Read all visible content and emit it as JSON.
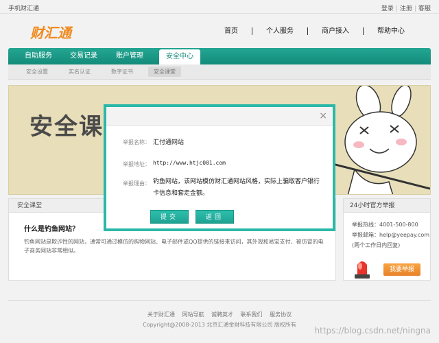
{
  "topbar": {
    "site_name": "手机财汇通",
    "login": "登录",
    "register": "注册",
    "service": "客服",
    "sep": "|"
  },
  "logo": {
    "text": "财汇通"
  },
  "main_nav": [
    {
      "label": "首页"
    },
    {
      "label": "个人服务"
    },
    {
      "label": "商户接入"
    },
    {
      "label": "帮助中心"
    }
  ],
  "tabs": [
    {
      "label": "自助服务"
    },
    {
      "label": "交易记录"
    },
    {
      "label": "账户管理"
    },
    {
      "label": "安全中心",
      "active": true
    }
  ],
  "subnav": [
    {
      "label": "安全设置"
    },
    {
      "label": "实名认证"
    },
    {
      "label": "数字证书"
    },
    {
      "label": "安全课堂",
      "active": true
    }
  ],
  "banner": {
    "title": "安全课堂"
  },
  "lesson": {
    "header": "安全课堂",
    "question": "什么是钓鱼网站？",
    "answer": "钓鱼网站是欺诈性的网站，通常可通过模仿的购物网站、电子邮件或QQ提供的链接来访问，其外观和易宝支付、被仿冒的电子商务网站非常相似。"
  },
  "report": {
    "header": "24小时官方举报",
    "hotline_label": "举报热线：",
    "hotline": "4001-500-800",
    "email_label": "举报邮箱：",
    "email": "help@yeepay.com",
    "hours": "(两个工作日内回复)",
    "button": "我要举报"
  },
  "footer": {
    "links": [
      "关于财汇通",
      "网站导航",
      "诚聘英才",
      "联系我们",
      "服务协议"
    ],
    "copyright": "Copyright@2008-2013 北京汇通金财科技有限公司 版权所有"
  },
  "watermark": "https://blog.csdn.net/ningna",
  "modal": {
    "close_glyph": "×",
    "name_label": "举报名称：",
    "name_value": "汇付通网站",
    "url_label": "举报地址：",
    "url_value": "http://www.htjc001.com",
    "reason_label": "举报理由：",
    "reason_value": "钓鱼网站，该网站模仿财汇通网站风格，实际上骗取客户银行卡信息和套走金额。",
    "submit": "提交",
    "back": "返回"
  },
  "colors": {
    "accent": "#1ea292",
    "modal_border": "#2bb8a8",
    "banner_bg": "#e8dfba",
    "report_button": "#f0902f"
  }
}
